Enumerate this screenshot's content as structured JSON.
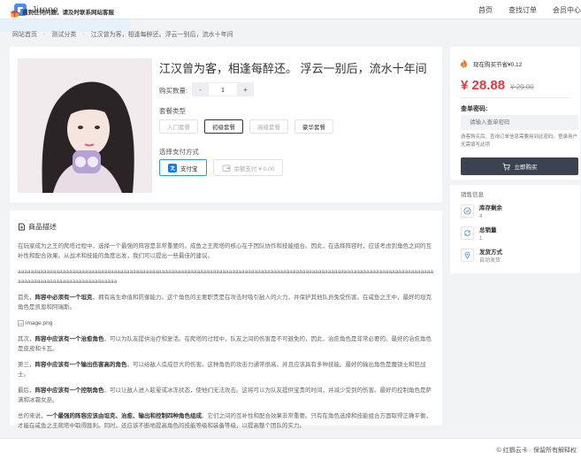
{
  "header": {
    "brand_name": "Jirono",
    "nav": [
      "首页",
      "查找订单",
      "会员中心"
    ]
  },
  "breadcrumb": [
    "网站首页",
    "测试分类",
    "江汉曾为客，相逢每醉还。浮云一别后，流水十年间"
  ],
  "product": {
    "title": "江汉曾为客，相逢每醉还。 浮云一别后，流水十年间",
    "qty_label": "购买数量:",
    "qty_minus": "-",
    "qty_value": "1",
    "qty_plus": "+",
    "package_label": "套餐类型",
    "packages": [
      {
        "label": "入门套餐",
        "state": "disabled"
      },
      {
        "label": "初级套餐",
        "state": "selected"
      },
      {
        "label": "高级套餐",
        "state": "disabled"
      },
      {
        "label": "豪华套餐",
        "state": "enabled"
      }
    ],
    "payment_label": "选择支付方式",
    "payments": [
      {
        "label": "支付宝",
        "icon": "alipay-icon",
        "state": "selected"
      },
      {
        "label": "余额支付 ¥ 0.00",
        "icon": "wallet-icon",
        "state": "disabled"
      }
    ]
  },
  "description": {
    "heading": "商品描述",
    "para1": "在玩家成为之王的爬塔过程中，选择一个最强的阵容是非常重要的。成鱼之王爬塔的核心在于团队协作和技能组合。因此，在选择阵容时，应该考虑到角色之间的互补性和配合效果。从战术和技能的角度出发，我们可以提出一些最佳的建议。",
    "para2": "aaaaaaaaaaaaaaaaaaaaaaaaaaaaaaaaaaaaaaaaaaaaaaaaaaaaaaaaaaaaaaaaaaaaaaaaaaaaaaaaaaaaaaaaaaaaaaaaaaaaaaaaaaaaaaaaaaaaaaaaaaaaaaaaaaaaaaaaaaaaaaaaaaaaaaaaaaaaaaaaa",
    "para3_bold": "阵容中必须有一个坦克",
    "para3_lead": "首先，",
    "para3_rest": "，拥有高生命值和防御能力。这个角色的主要职责是在攻击时吸引敌人的火力，并保护其他队员免受伤害。在咸鱼之王中，最好的坦克角色是凯恩和阿瑞斯。",
    "image_alt": "image.png",
    "para4_lead": "其次，",
    "para4_bold": "阵容中应该有一个治愈角色",
    "para4_rest": "，可以为队友提供治疗和复活。在爬塔的过程中，队友之间的伤害是不可避免的，因此，治愈角色是非常必要的。最好的治愈角色是皮皮和卡瓦。",
    "para5_lead": "第三，",
    "para5_bold": "阵容中应该有一个输出伤害高的角色",
    "para5_rest": "，可以给敌人造成巨大的伤害。这种角色的攻击力通常很高，并且应该具有多种技能。最好的输出角色是魔锁士和狂战士。",
    "para6_lead": "最后，",
    "para6_bold": "阵容中应该有一个控制角色",
    "para6_rest": "，可以让敌人进入眩晕或冰冻状态，使他们无法攻击。这将可以为队友提供宝贵的时间，并减少受到的伤害。最好的控制角色是萨满和冰霜女巫。",
    "para7_lead": "总的来说，",
    "para7_bold": "一个最强的阵容应该由坦克、治愈、输出和控制四种角色组成",
    "para7_rest": "。它们之间的互补性和配合效果非常重要。只有在角色选择和技能组合方面取得正确平衡，才能在咸鱼之王爬塔中取得胜利。同时，还应该不断地提高角色的技能等级和装备等级，以提高整个团队的实力。"
  },
  "purchase": {
    "save_text": "现在购买节省¥0.12",
    "price_now": "¥ 28.88",
    "price_old": "¥ 29.00",
    "query_label": "查单密码:",
    "query_placeholder": "请输入查单密码",
    "query_hint": "游客购买后，查询订单信息需要用到此密码。登录用户无需填写此项",
    "buy_label": "立即购买"
  },
  "sales": {
    "title": "销售信息",
    "stats": [
      {
        "name": "库存剩余",
        "value": "4",
        "icon": "check-shield-icon"
      },
      {
        "name": "总销量",
        "value": "1",
        "icon": "sync-icon"
      },
      {
        "name": "发货方式",
        "value": "自动发货",
        "icon": "location-pin-icon"
      }
    ]
  },
  "notice": {
    "text": "遇到任何问题，请及时联系网站客服"
  },
  "footer": {
    "text": "© 红鹦云卡 · 保留所有解释权"
  },
  "colors": {
    "price": "#e4393c",
    "buy_button": "#3b4350",
    "selected_payment": "#3b8fe6",
    "notice_bg": "#e6f2fb"
  }
}
